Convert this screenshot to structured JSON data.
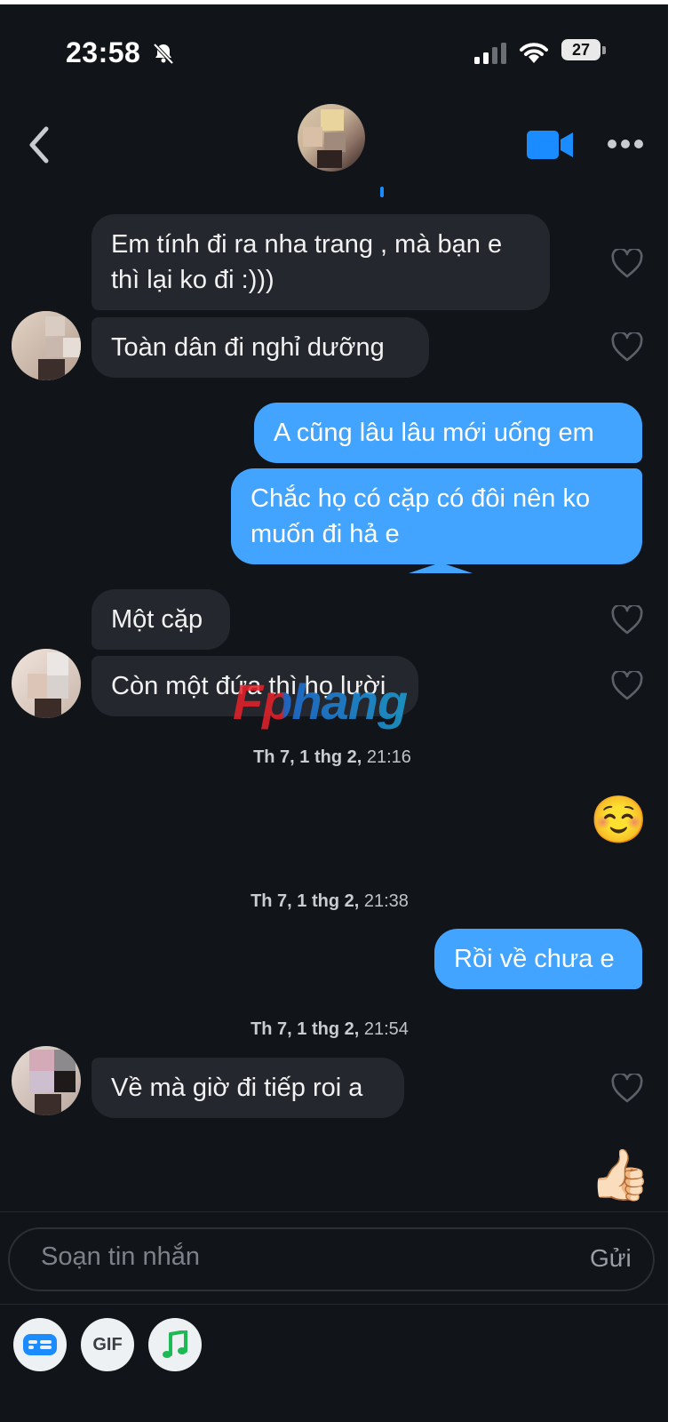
{
  "status": {
    "time": "23:58",
    "battery": "27"
  },
  "header": {
    "back_icon": "chevron-left-icon",
    "video_icon": "video-camera-icon",
    "more_icon": "more-horizontal-icon"
  },
  "messages": [
    {
      "side": "in",
      "text_lines": [
        "Em tính đi ra nha trang , mà bạn e",
        "thì lại ko đi :)))"
      ]
    },
    {
      "side": "in",
      "text_lines": [
        "Toàn dân đi nghỉ dưỡng"
      ]
    },
    {
      "side": "out",
      "text_lines": [
        "A cũng lâu lâu mới uống em"
      ]
    },
    {
      "side": "out",
      "text_lines": [
        "Chắc họ có cặp có đôi nên ko",
        "muốn đi hả e"
      ]
    },
    {
      "side": "in",
      "text_lines": [
        "Một cặp"
      ]
    },
    {
      "side": "in",
      "text_lines": [
        "Còn một đứa thì họ lười"
      ]
    },
    {
      "side": "stamp",
      "day": "Th 7, 1 thg 2,",
      "time": "21:16"
    },
    {
      "side": "out",
      "emoji": "☺️"
    },
    {
      "side": "stamp",
      "day": "Th 7, 1 thg 2,",
      "time": "21:38"
    },
    {
      "side": "out",
      "text_lines": [
        "Rồi về chưa e"
      ]
    },
    {
      "side": "stamp",
      "day": "Th 7, 1 thg 2,",
      "time": "21:54"
    },
    {
      "side": "in",
      "text_lines": [
        "Về mà giờ đi tiếp roi a"
      ]
    },
    {
      "side": "out",
      "emoji": "👍🏻"
    }
  ],
  "composer": {
    "placeholder": "Soạn tin nhắn",
    "send_label": "Gửi"
  },
  "toolbar": {
    "gif_label": "GIF",
    "sticker_icon": "id-card-icon",
    "music_icon": "music-note-icon"
  },
  "watermark": {
    "text": "Fphang"
  },
  "colors": {
    "background": "#111418",
    "incoming_bubble": "#24272d",
    "outgoing_bubble": "#43a4ff",
    "accent": "#1a8cff"
  }
}
